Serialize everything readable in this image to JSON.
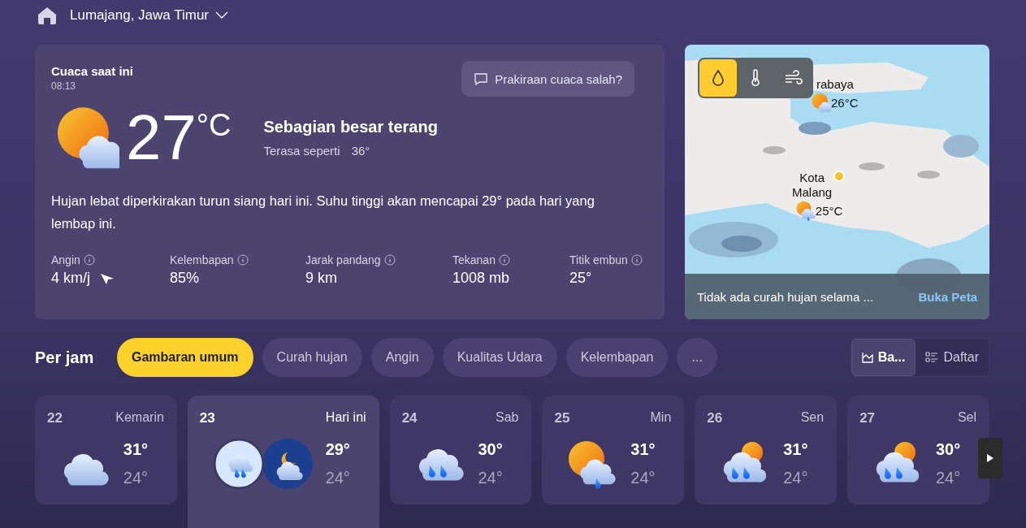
{
  "header": {
    "location": "Lumajang, Jawa Timur"
  },
  "current": {
    "title": "Cuaca saat ini",
    "time": "08:13",
    "feedback": "Prakiraan cuaca salah?",
    "temp": "27",
    "unit": "°C",
    "condition": "Sebagian besar terang",
    "feels_label": "Terasa seperti",
    "feels_value": "36°",
    "summary": "Hujan lebat diperkirakan turun siang hari ini. Suhu tinggi akan mencapai 29° pada hari yang lembap ini.",
    "stats": [
      {
        "label": "Angin",
        "value": "4 km/j",
        "kind": "wind"
      },
      {
        "label": "Kelembapan",
        "value": "85%",
        "kind": "plain"
      },
      {
        "label": "Jarak pandang",
        "value": "9 km",
        "kind": "plain"
      },
      {
        "label": "Tekanan",
        "value": "1008 mb",
        "kind": "plain"
      },
      {
        "label": "Titik embun",
        "value": "25°",
        "kind": "plain"
      }
    ]
  },
  "map": {
    "layers": [
      {
        "kind": "rain",
        "selected": true
      },
      {
        "kind": "temp",
        "selected": false
      },
      {
        "kind": "wind",
        "selected": false
      }
    ],
    "pins": [
      {
        "name": "rabaya",
        "temp": "26°C",
        "kind": "sun-cloud"
      },
      {
        "name": "Kota\nMalang",
        "temp": "25°C",
        "kind": "sun-rain"
      }
    ],
    "footer": "Tidak ada curah hujan selama ...",
    "link": "Buka Peta"
  },
  "hourly": {
    "title": "Per jam",
    "tabs": [
      {
        "label": "Gambaran umum",
        "selected": true
      },
      {
        "label": "Curah hujan",
        "selected": false
      },
      {
        "label": "Angin",
        "selected": false
      },
      {
        "label": "Kualitas Udara",
        "selected": false
      },
      {
        "label": "Kelembapan",
        "selected": false
      },
      {
        "label": "...",
        "selected": false
      }
    ],
    "views": [
      {
        "label": "Ba...",
        "kind": "chart",
        "selected": true
      },
      {
        "label": "Daftar",
        "kind": "list",
        "selected": false
      }
    ]
  },
  "days": [
    {
      "date": "22",
      "day": "Kemarin",
      "high": "31°",
      "low": "24°",
      "kind": "cloud",
      "selected": false
    },
    {
      "date": "23",
      "day": "Hari ini",
      "high": "29°",
      "low": "24°",
      "kind": "rain-night",
      "selected": true
    },
    {
      "date": "24",
      "day": "Sab",
      "high": "30°",
      "low": "24°",
      "kind": "rain",
      "selected": false
    },
    {
      "date": "25",
      "day": "Min",
      "high": "31°",
      "low": "24°",
      "kind": "sun-rain",
      "selected": false
    },
    {
      "date": "26",
      "day": "Sen",
      "high": "31°",
      "low": "24°",
      "kind": "sun-heavy-rain",
      "selected": false
    },
    {
      "date": "27",
      "day": "Sel",
      "high": "30°",
      "low": "24°",
      "kind": "sun-heavy-rain",
      "selected": false
    }
  ]
}
